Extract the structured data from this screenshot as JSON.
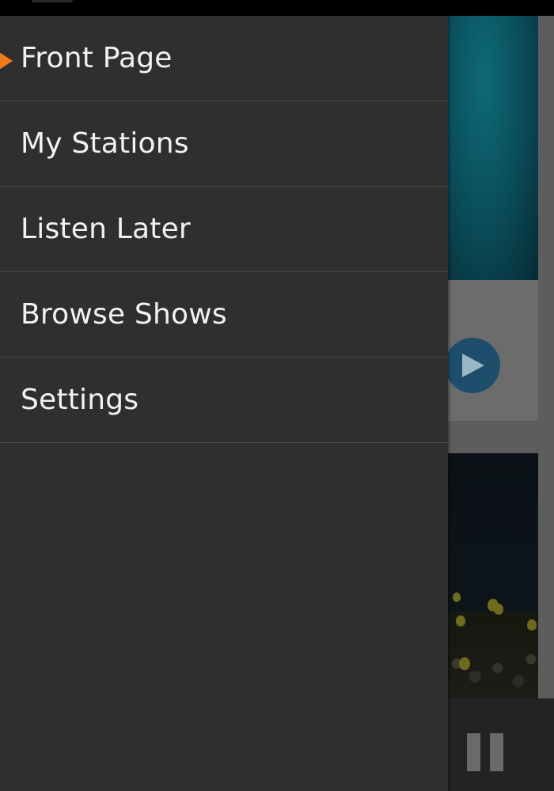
{
  "drawer": {
    "items": [
      {
        "label": "Front Page"
      },
      {
        "label": "My Stations"
      },
      {
        "label": "Listen Later"
      },
      {
        "label": "Browse Shows"
      },
      {
        "label": "Settings"
      }
    ],
    "active_index": 0
  },
  "colors": {
    "drawer_background": "#2f2f2f",
    "active_marker": "#f07b1d",
    "divider": "#484848",
    "label_text": "#f2f2f2"
  },
  "icons": {
    "active_marker": "active-item-marker-icon",
    "play": "play-icon",
    "pause": "pause-icon"
  }
}
